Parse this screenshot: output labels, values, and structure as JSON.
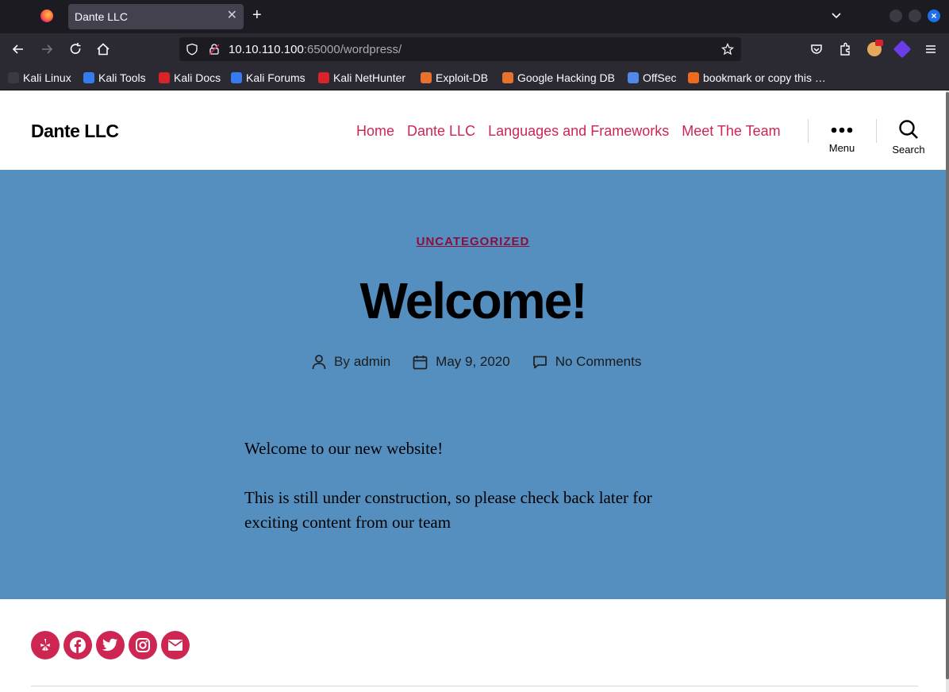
{
  "browser": {
    "tab_title": "Dante LLC",
    "url_host": "10.10.110.100",
    "url_rest": ":65000/wordpress/",
    "bookmarks": [
      {
        "label": "Kali Linux",
        "icon": "kali-dragon-icon",
        "color": "#3a3a44"
      },
      {
        "label": "Kali Tools",
        "icon": "kali-tools-icon",
        "color": "#367bf0"
      },
      {
        "label": "Kali Docs",
        "icon": "kali-docs-icon",
        "color": "#d8232a"
      },
      {
        "label": "Kali Forums",
        "icon": "kali-forums-icon",
        "color": "#367bf0"
      },
      {
        "label": "Kali NetHunter",
        "icon": "nethunter-icon",
        "color": "#d8232a"
      },
      {
        "label": "Exploit-DB",
        "icon": "exploit-db-icon",
        "color": "#e8722c"
      },
      {
        "label": "Google Hacking DB",
        "icon": "ghdb-icon",
        "color": "#e8722c"
      },
      {
        "label": "OffSec",
        "icon": "offsec-icon",
        "color": "#4f8ae8"
      },
      {
        "label": "bookmark or copy this …",
        "icon": "bookmark-icon",
        "color": "#f06a1d"
      }
    ]
  },
  "site": {
    "title": "Dante LLC",
    "menu": [
      "Home",
      "Dante LLC",
      "Languages and Frameworks",
      "Meet The Team"
    ],
    "menu_toggle_label": "Menu",
    "search_toggle_label": "Search",
    "accent_color": "#cd2653",
    "hero_color": "#558fc0"
  },
  "post": {
    "category": "UNCATEGORIZED",
    "title": "Welcome!",
    "author_prefix": "By",
    "author": "admin",
    "date": "May 9, 2020",
    "comments": "No Comments",
    "paragraphs": [
      "Welcome to our new website!",
      "This is still under construction, so please check back later for exciting content from our team"
    ]
  },
  "footer": {
    "social_icons": [
      "yelp-icon",
      "facebook-icon",
      "twitter-icon",
      "instagram-icon",
      "email-icon"
    ]
  }
}
